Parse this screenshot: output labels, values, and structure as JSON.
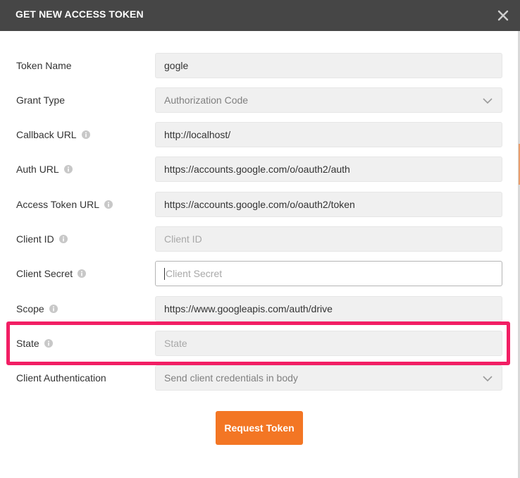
{
  "dialog": {
    "title": "GET NEW ACCESS TOKEN",
    "close_icon": "close-icon"
  },
  "fields": {
    "token_name": {
      "label": "Token Name",
      "value": "gogle"
    },
    "grant_type": {
      "label": "Grant Type",
      "value": "Authorization Code"
    },
    "callback_url": {
      "label": "Callback URL",
      "value": "http://localhost/"
    },
    "auth_url": {
      "label": "Auth URL",
      "value": "https://accounts.google.com/o/oauth2/auth"
    },
    "access_token_url": {
      "label": "Access Token URL",
      "value": "https://accounts.google.com/o/oauth2/token"
    },
    "client_id": {
      "label": "Client ID",
      "value": "",
      "placeholder": "Client ID"
    },
    "client_secret": {
      "label": "Client Secret",
      "value": "",
      "placeholder": "Client Secret"
    },
    "scope": {
      "label": "Scope",
      "value": "https://www.googleapis.com/auth/drive"
    },
    "state": {
      "label": "State",
      "value": "",
      "placeholder": "State"
    },
    "client_authentication": {
      "label": "Client Authentication",
      "value": "Send client credentials in body"
    }
  },
  "actions": {
    "request_token_label": "Request Token"
  },
  "colors": {
    "header_bg": "#464646",
    "accent": "#f37624",
    "highlight": "#f21e64",
    "field_bg": "#f0f0f0"
  }
}
